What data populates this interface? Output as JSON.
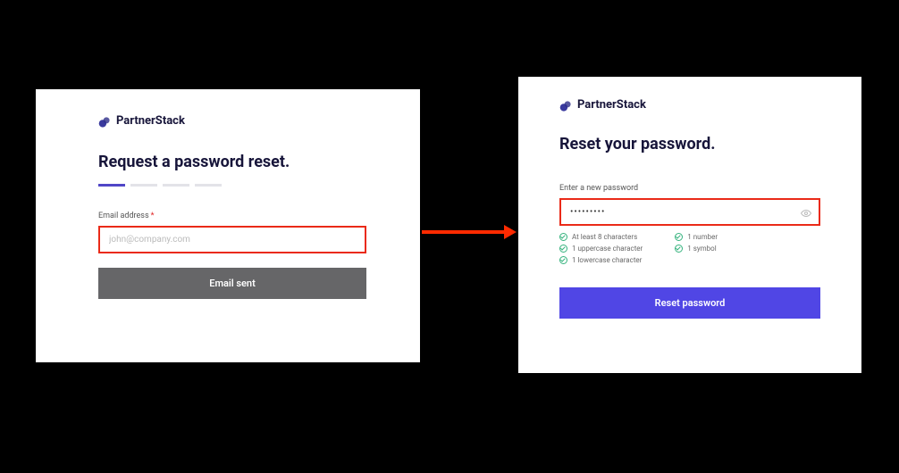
{
  "brand": {
    "name": "PartnerStack"
  },
  "left": {
    "heading": "Request a password reset.",
    "email_label": "Email address",
    "email_placeholder": "john@company.com",
    "email_value": "",
    "button_label": "Email sent"
  },
  "right": {
    "heading": "Reset your password.",
    "password_label": "Enter a new password",
    "password_value": "•••••••••",
    "rules": {
      "r1": "At least 8 characters",
      "r2": "1 uppercase character",
      "r3": "1 lowercase character",
      "r4": "1 number",
      "r5": "1 symbol"
    },
    "button_label": "Reset password"
  }
}
